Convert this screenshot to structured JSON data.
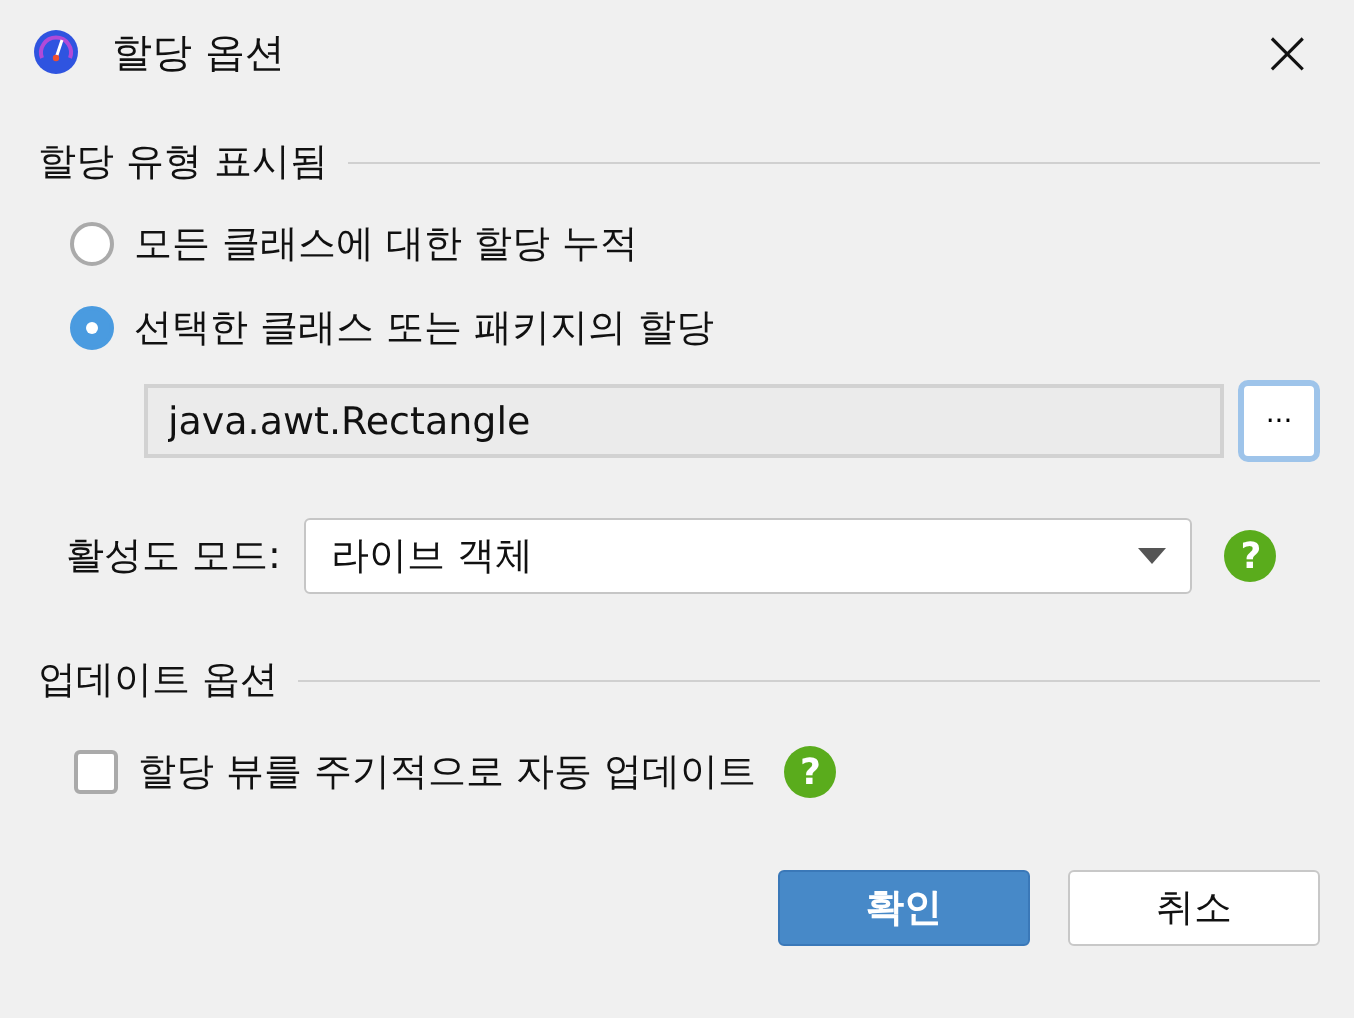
{
  "window": {
    "title": "할당 옵션",
    "close": "×"
  },
  "display_section": {
    "heading": "할당 유형 표시됨",
    "options": [
      {
        "label": "모든 클래스에 대한 할당 누적",
        "selected": false
      },
      {
        "label": "선택한 클래스 또는 패키지의 할당",
        "selected": true
      }
    ],
    "class_field": {
      "value": "java.awt.Rectangle"
    },
    "browse_button": "···",
    "mode": {
      "label": "활성도 모드:",
      "value": "라이브 객체",
      "help": "?"
    }
  },
  "update_section": {
    "heading": "업데이트 옵션",
    "auto_update": {
      "label": "할당 뷰를 주기적으로 자동 업데이트",
      "checked": false,
      "help": "?"
    }
  },
  "buttons": [
    {
      "label": "확인",
      "kind": "primary"
    },
    {
      "label": "취소",
      "kind": "secondary"
    }
  ]
}
